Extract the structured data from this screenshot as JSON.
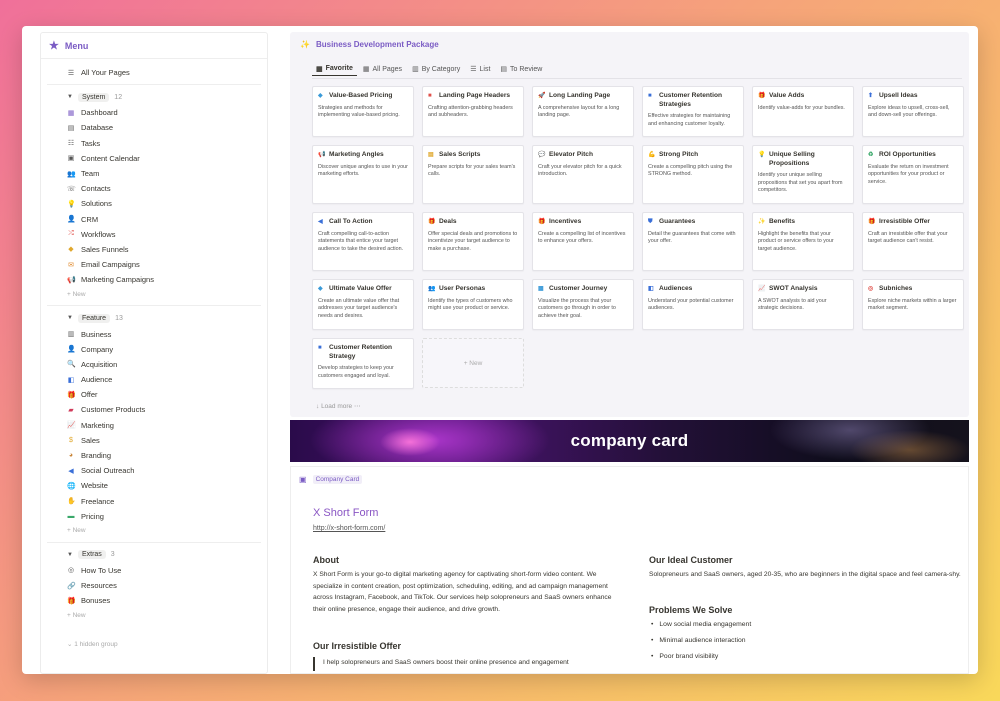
{
  "sidebar": {
    "menu_title": "Menu",
    "all_pages": "All Your Pages",
    "groups": [
      {
        "name": "System",
        "count": "12",
        "items": [
          "Dashboard",
          "Database",
          "Tasks",
          "Content Calendar",
          "Team",
          "Contacts",
          "Solutions",
          "CRM",
          "Workflows",
          "Sales Funnels",
          "Email Campaigns",
          "Marketing Campaigns"
        ]
      },
      {
        "name": "Feature",
        "count": "13",
        "items": [
          "Business",
          "Company",
          "Acquisition",
          "Audience",
          "Offer",
          "Customer Products",
          "Marketing",
          "Sales",
          "Branding",
          "Social Outreach",
          "Website",
          "Freelance",
          "Pricing"
        ]
      },
      {
        "name": "Extras",
        "count": "3",
        "items": [
          "How To Use",
          "Resources",
          "Bonuses"
        ]
      }
    ],
    "new_label": "+ New",
    "hidden_group": "1 hidden group"
  },
  "package": {
    "title": "Business Development Package",
    "tabs": [
      "Favorite",
      "All Pages",
      "By Category",
      "List",
      "To Review"
    ],
    "cards": [
      {
        "title": "Value-Based Pricing",
        "desc": "Strategies and methods for implementing value-based pricing."
      },
      {
        "title": "Landing Page Headers",
        "desc": "Crafting attention-grabbing headers and subheaders."
      },
      {
        "title": "Long Landing Page",
        "desc": "A comprehensive layout for a long landing page."
      },
      {
        "title": "Customer Retention Strategies",
        "desc": "Effective strategies for maintaining and enhancing customer loyalty."
      },
      {
        "title": "Value Adds",
        "desc": "Identify value-adds for your bundles."
      },
      {
        "title": "Upsell Ideas",
        "desc": "Explore ideas to upsell, cross-sell, and down-sell your offerings."
      },
      {
        "title": "Marketing Angles",
        "desc": "Discover unique angles to use in your marketing efforts."
      },
      {
        "title": "Sales Scripts",
        "desc": "Prepare scripts for your sales team's calls."
      },
      {
        "title": "Elevator Pitch",
        "desc": "Craft your elevator pitch for a quick introduction."
      },
      {
        "title": "Strong Pitch",
        "desc": "Create a compelling pitch using the STRONG method."
      },
      {
        "title": "Unique Selling Propositions",
        "desc": "Identify your unique selling propositions that set you apart from competitors."
      },
      {
        "title": "ROI Opportunities",
        "desc": "Evaluate the return on investment opportunities for your product or service."
      },
      {
        "title": "Call To Action",
        "desc": "Craft compelling call-to-action statements that entice your target audience to take the desired action."
      },
      {
        "title": "Deals",
        "desc": "Offer special deals and promotions to incentivize your target audience to make a purchase."
      },
      {
        "title": "Incentives",
        "desc": "Create a compelling list of incentives to enhance your offers."
      },
      {
        "title": "Guarantees",
        "desc": "Detail the guarantees that come with your offer."
      },
      {
        "title": "Benefits",
        "desc": "Highlight the benefits that your product or service offers to your target audience."
      },
      {
        "title": "Irresistible Offer",
        "desc": "Craft an irresistible offer that your target audience can't resist."
      },
      {
        "title": "Ultimate Value Offer",
        "desc": "Create an ultimate value offer that addresses your target audience's needs and desires."
      },
      {
        "title": "User Personas",
        "desc": "Identify the types of customers who might use your product or service."
      },
      {
        "title": "Customer Journey",
        "desc": "Visualize the process that your customers go through in order to achieve their goal."
      },
      {
        "title": "Audiences",
        "desc": "Understand your potential customer audiences."
      },
      {
        "title": "SWOT Analysis",
        "desc": "A SWOT analysis to aid your strategic decisions."
      },
      {
        "title": "Subniches",
        "desc": "Explore niche markets within a larger market segment."
      },
      {
        "title": "Customer Retention Strategy",
        "desc": "Develop strategies to keep your customers engaged and loyal."
      }
    ],
    "new_label": "+ New",
    "load_more": "Load more"
  },
  "banner": {
    "text": "company card"
  },
  "company": {
    "tag": "Company Card",
    "name": "X Short Form",
    "url": "http://x-short-form.com/",
    "about_title": "About",
    "about_text": "X Short Form is your go-to digital marketing agency for captivating short-form video content. We specialize in content creation, post optimization, scheduling, editing, and ad campaign management across Instagram, Facebook, and TikTok. Our services help solopreneurs and SaaS owners enhance their online presence, engage their audience, and drive growth.",
    "offer_title": "Our Irresistible Offer",
    "offer_text": "I help solopreneurs and SaaS owners boost their online presence and engagement",
    "ideal_title": "Our Ideal Customer",
    "ideal_text": "Solopreneurs and SaaS owners, aged 20-35, who are beginners in the digital space and feel camera-shy.",
    "problems_title": "Problems We Solve",
    "problems": [
      "Low social media engagement",
      "Minimal audience interaction",
      "Poor brand visibility"
    ]
  }
}
